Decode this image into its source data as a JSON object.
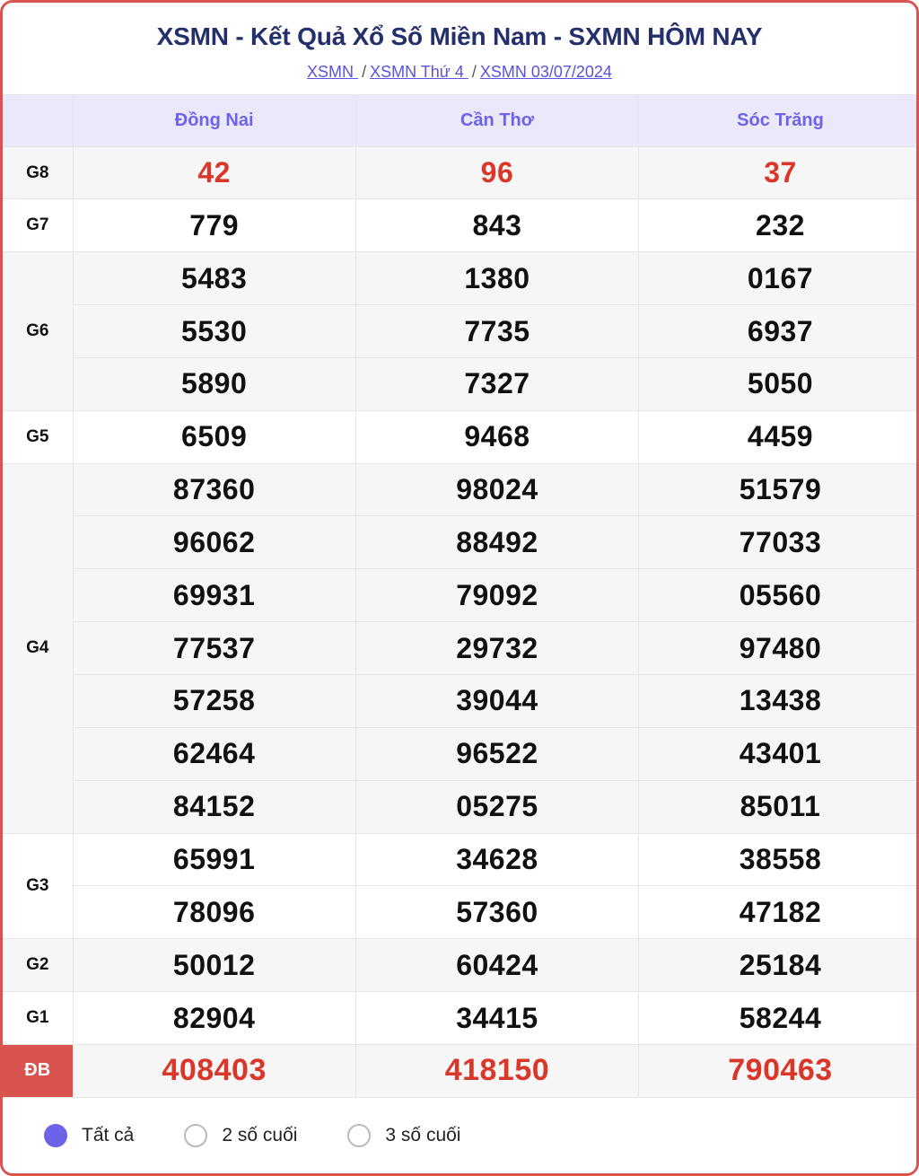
{
  "header": {
    "title": "XSMN - Kết Quả Xổ Số Miền Nam - SXMN HÔM NAY",
    "breadcrumb": {
      "item1": "XSMN ",
      "sep1": "/",
      "item2": "XSMN Thứ 4 ",
      "sep2": "/",
      "item3": "XSMN 03/07/2024"
    }
  },
  "table": {
    "blank_header": "",
    "provinces": [
      "Đồng Nai",
      "Cần Thơ",
      "Sóc Trăng"
    ],
    "prizes": [
      {
        "label": "G8",
        "shade": true,
        "color": "red",
        "rows": [
          [
            "42",
            "96",
            "37"
          ]
        ]
      },
      {
        "label": "G7",
        "shade": false,
        "color": "black",
        "rows": [
          [
            "779",
            "843",
            "232"
          ]
        ]
      },
      {
        "label": "G6",
        "shade": true,
        "color": "black",
        "rows": [
          [
            "5483",
            "1380",
            "0167"
          ],
          [
            "5530",
            "7735",
            "6937"
          ],
          [
            "5890",
            "7327",
            "5050"
          ]
        ]
      },
      {
        "label": "G5",
        "shade": false,
        "color": "black",
        "rows": [
          [
            "6509",
            "9468",
            "4459"
          ]
        ]
      },
      {
        "label": "G4",
        "shade": true,
        "color": "black",
        "rows": [
          [
            "87360",
            "98024",
            "51579"
          ],
          [
            "96062",
            "88492",
            "77033"
          ],
          [
            "69931",
            "79092",
            "05560"
          ],
          [
            "77537",
            "29732",
            "97480"
          ],
          [
            "57258",
            "39044",
            "13438"
          ],
          [
            "62464",
            "96522",
            "43401"
          ],
          [
            "84152",
            "05275",
            "85011"
          ]
        ]
      },
      {
        "label": "G3",
        "shade": false,
        "color": "black",
        "rows": [
          [
            "65991",
            "34628",
            "38558"
          ],
          [
            "78096",
            "57360",
            "47182"
          ]
        ]
      },
      {
        "label": "G2",
        "shade": true,
        "color": "black",
        "rows": [
          [
            "50012",
            "60424",
            "25184"
          ]
        ]
      },
      {
        "label": "G1",
        "shade": false,
        "color": "black",
        "rows": [
          [
            "82904",
            "34415",
            "58244"
          ]
        ]
      },
      {
        "label": "ĐB",
        "shade": true,
        "color": "db",
        "is_db": true,
        "rows": [
          [
            "408403",
            "418150",
            "790463"
          ]
        ]
      }
    ]
  },
  "footer": {
    "options": [
      {
        "label": "Tất cả",
        "selected": true
      },
      {
        "label": "2 số cuối",
        "selected": false
      },
      {
        "label": "3 số cuối",
        "selected": false
      }
    ]
  },
  "colors": {
    "border": "#d9534f",
    "title": "#24306b",
    "link": "#5a52dd",
    "header_bg": "#eae8f9",
    "header_text": "#6c63e8",
    "highlight_red": "#d8372a",
    "db_badge_bg": "#d9534f",
    "radio_on": "#6c63e8",
    "row_shade": "#f6f6f6"
  }
}
